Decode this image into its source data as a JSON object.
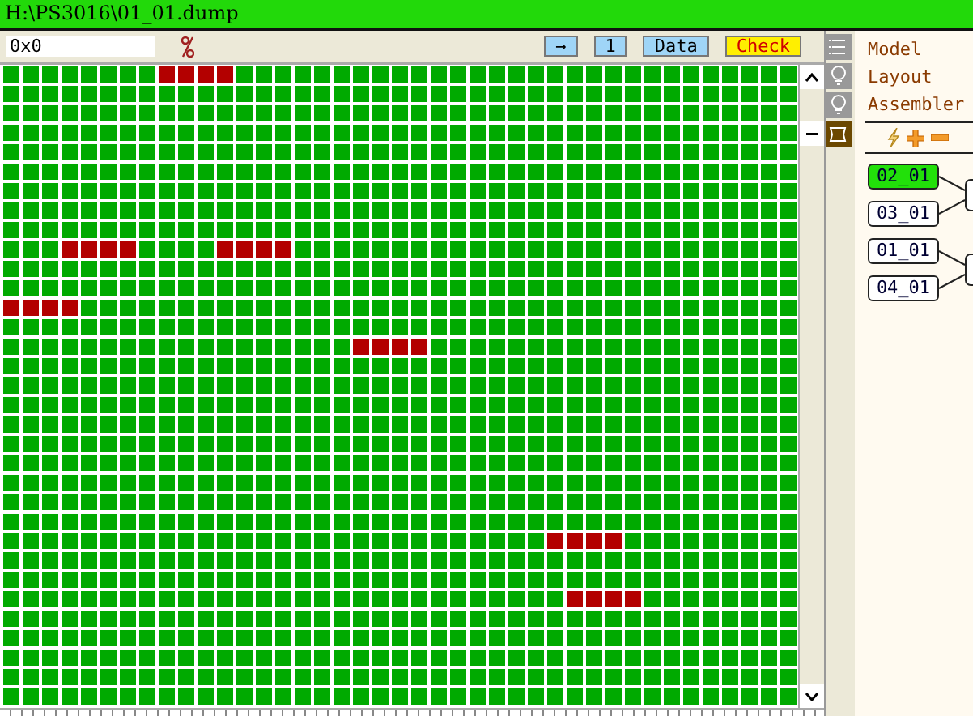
{
  "window": {
    "title": "H:\\PS3016\\01_01.dump"
  },
  "toolbar": {
    "address": {
      "value": "0x0"
    },
    "buttons": [
      {
        "label": "→",
        "kind": "plain"
      },
      {
        "label": "1",
        "kind": "plain"
      },
      {
        "label": "Data",
        "kind": "plain"
      },
      {
        "label": "Check",
        "kind": "warning"
      }
    ]
  },
  "grid": {
    "rows": [
      {
        "marked": [
          false,
          false,
          false,
          false,
          false,
          false,
          false,
          false,
          true,
          true,
          true,
          true,
          false,
          false,
          false,
          false,
          false,
          false,
          false,
          false,
          false,
          false,
          false,
          false,
          false,
          false,
          false,
          false,
          false,
          false,
          false,
          false,
          false,
          false,
          false,
          false,
          false,
          false,
          false,
          false,
          false
        ]
      },
      {
        "marked": [
          false,
          false,
          false,
          false,
          false,
          false,
          false,
          false,
          false,
          false,
          false,
          false,
          false,
          false,
          false,
          false,
          false,
          false,
          false,
          false,
          false,
          false,
          false,
          false,
          false,
          false,
          false,
          false,
          false,
          false,
          false,
          false,
          false,
          false,
          false,
          false,
          false,
          false,
          false,
          false,
          false
        ]
      },
      {
        "marked": [
          false,
          false,
          false,
          false,
          false,
          false,
          false,
          false,
          false,
          false,
          false,
          false,
          false,
          false,
          false,
          false,
          false,
          false,
          false,
          false,
          false,
          false,
          false,
          false,
          false,
          false,
          false,
          false,
          false,
          false,
          false,
          false,
          false,
          false,
          false,
          false,
          false,
          false,
          false,
          false,
          false
        ]
      },
      {
        "marked": [
          false,
          false,
          false,
          false,
          false,
          false,
          false,
          false,
          false,
          false,
          false,
          false,
          false,
          false,
          false,
          false,
          false,
          false,
          false,
          false,
          false,
          false,
          false,
          false,
          false,
          false,
          false,
          false,
          false,
          false,
          false,
          false,
          false,
          false,
          false,
          false,
          false,
          false,
          false,
          false,
          false
        ]
      },
      {
        "marked": [
          false,
          false,
          false,
          false,
          false,
          false,
          false,
          false,
          false,
          false,
          false,
          false,
          false,
          false,
          false,
          false,
          false,
          false,
          false,
          false,
          false,
          false,
          false,
          false,
          false,
          false,
          false,
          false,
          false,
          false,
          false,
          false,
          false,
          false,
          false,
          false,
          false,
          false,
          false,
          false,
          false
        ]
      },
      {
        "marked": [
          false,
          false,
          false,
          false,
          false,
          false,
          false,
          false,
          false,
          false,
          false,
          false,
          false,
          false,
          false,
          false,
          false,
          false,
          false,
          false,
          false,
          false,
          false,
          false,
          false,
          false,
          false,
          false,
          false,
          false,
          false,
          false,
          false,
          false,
          false,
          false,
          false,
          false,
          false,
          false,
          false
        ]
      },
      {
        "marked": [
          false,
          false,
          false,
          false,
          false,
          false,
          false,
          false,
          false,
          false,
          false,
          false,
          false,
          false,
          false,
          false,
          false,
          false,
          false,
          false,
          false,
          false,
          false,
          false,
          false,
          false,
          false,
          false,
          false,
          false,
          false,
          false,
          false,
          false,
          false,
          false,
          false,
          false,
          false,
          false,
          false
        ]
      },
      {
        "marked": [
          false,
          false,
          false,
          false,
          false,
          false,
          false,
          false,
          false,
          false,
          false,
          false,
          false,
          false,
          false,
          false,
          false,
          false,
          false,
          false,
          false,
          false,
          false,
          false,
          false,
          false,
          false,
          false,
          false,
          false,
          false,
          false,
          false,
          false,
          false,
          false,
          false,
          false,
          false,
          false,
          false
        ]
      },
      {
        "marked": [
          false,
          false,
          false,
          false,
          false,
          false,
          false,
          false,
          false,
          false,
          false,
          false,
          false,
          false,
          false,
          false,
          false,
          false,
          false,
          false,
          false,
          false,
          false,
          false,
          false,
          false,
          false,
          false,
          false,
          false,
          false,
          false,
          false,
          false,
          false,
          false,
          false,
          false,
          false,
          false,
          false
        ]
      },
      {
        "marked": [
          false,
          false,
          false,
          true,
          true,
          true,
          true,
          false,
          false,
          false,
          false,
          true,
          true,
          true,
          true,
          false,
          false,
          false,
          false,
          false,
          false,
          false,
          false,
          false,
          false,
          false,
          false,
          false,
          false,
          false,
          false,
          false,
          false,
          false,
          false,
          false,
          false,
          false,
          false,
          false,
          false
        ]
      },
      {
        "marked": [
          false,
          false,
          false,
          false,
          false,
          false,
          false,
          false,
          false,
          false,
          false,
          false,
          false,
          false,
          false,
          false,
          false,
          false,
          false,
          false,
          false,
          false,
          false,
          false,
          false,
          false,
          false,
          false,
          false,
          false,
          false,
          false,
          false,
          false,
          false,
          false,
          false,
          false,
          false,
          false,
          false
        ]
      },
      {
        "marked": [
          false,
          false,
          false,
          false,
          false,
          false,
          false,
          false,
          false,
          false,
          false,
          false,
          false,
          false,
          false,
          false,
          false,
          false,
          false,
          false,
          false,
          false,
          false,
          false,
          false,
          false,
          false,
          false,
          false,
          false,
          false,
          false,
          false,
          false,
          false,
          false,
          false,
          false,
          false,
          false,
          false
        ]
      },
      {
        "marked": [
          true,
          true,
          true,
          true,
          false,
          false,
          false,
          false,
          false,
          false,
          false,
          false,
          false,
          false,
          false,
          false,
          false,
          false,
          false,
          false,
          false,
          false,
          false,
          false,
          false,
          false,
          false,
          false,
          false,
          false,
          false,
          false,
          false,
          false,
          false,
          false,
          false,
          false,
          false,
          false,
          false
        ]
      },
      {
        "marked": [
          false,
          false,
          false,
          false,
          false,
          false,
          false,
          false,
          false,
          false,
          false,
          false,
          false,
          false,
          false,
          false,
          false,
          false,
          false,
          false,
          false,
          false,
          false,
          false,
          false,
          false,
          false,
          false,
          false,
          false,
          false,
          false,
          false,
          false,
          false,
          false,
          false,
          false,
          false,
          false,
          false
        ]
      },
      {
        "marked": [
          false,
          false,
          false,
          false,
          false,
          false,
          false,
          false,
          false,
          false,
          false,
          false,
          false,
          false,
          false,
          false,
          false,
          false,
          true,
          true,
          true,
          true,
          false,
          false,
          false,
          false,
          false,
          false,
          false,
          false,
          false,
          false,
          false,
          false,
          false,
          false,
          false,
          false,
          false,
          false,
          false
        ]
      },
      {
        "marked": [
          false,
          false,
          false,
          false,
          false,
          false,
          false,
          false,
          false,
          false,
          false,
          false,
          false,
          false,
          false,
          false,
          false,
          false,
          false,
          false,
          false,
          false,
          false,
          false,
          false,
          false,
          false,
          false,
          false,
          false,
          false,
          false,
          false,
          false,
          false,
          false,
          false,
          false,
          false,
          false,
          false
        ]
      },
      {
        "marked": [
          false,
          false,
          false,
          false,
          false,
          false,
          false,
          false,
          false,
          false,
          false,
          false,
          false,
          false,
          false,
          false,
          false,
          false,
          false,
          false,
          false,
          false,
          false,
          false,
          false,
          false,
          false,
          false,
          false,
          false,
          false,
          false,
          false,
          false,
          false,
          false,
          false,
          false,
          false,
          false,
          false
        ]
      },
      {
        "marked": [
          false,
          false,
          false,
          false,
          false,
          false,
          false,
          false,
          false,
          false,
          false,
          false,
          false,
          false,
          false,
          false,
          false,
          false,
          false,
          false,
          false,
          false,
          false,
          false,
          false,
          false,
          false,
          false,
          false,
          false,
          false,
          false,
          false,
          false,
          false,
          false,
          false,
          false,
          false,
          false,
          false
        ]
      },
      {
        "marked": [
          false,
          false,
          false,
          false,
          false,
          false,
          false,
          false,
          false,
          false,
          false,
          false,
          false,
          false,
          false,
          false,
          false,
          false,
          false,
          false,
          false,
          false,
          false,
          false,
          false,
          false,
          false,
          false,
          false,
          false,
          false,
          false,
          false,
          false,
          false,
          false,
          false,
          false,
          false,
          false,
          false
        ]
      },
      {
        "marked": [
          false,
          false,
          false,
          false,
          false,
          false,
          false,
          false,
          false,
          false,
          false,
          false,
          false,
          false,
          false,
          false,
          false,
          false,
          false,
          false,
          false,
          false,
          false,
          false,
          false,
          false,
          false,
          false,
          false,
          false,
          false,
          false,
          false,
          false,
          false,
          false,
          false,
          false,
          false,
          false,
          false
        ]
      },
      {
        "marked": [
          false,
          false,
          false,
          false,
          false,
          false,
          false,
          false,
          false,
          false,
          false,
          false,
          false,
          false,
          false,
          false,
          false,
          false,
          false,
          false,
          false,
          false,
          false,
          false,
          false,
          false,
          false,
          false,
          false,
          false,
          false,
          false,
          false,
          false,
          false,
          false,
          false,
          false,
          false,
          false,
          false
        ]
      },
      {
        "marked": [
          false,
          false,
          false,
          false,
          false,
          false,
          false,
          false,
          false,
          false,
          false,
          false,
          false,
          false,
          false,
          false,
          false,
          false,
          false,
          false,
          false,
          false,
          false,
          false,
          false,
          false,
          false,
          false,
          false,
          false,
          false,
          false,
          false,
          false,
          false,
          false,
          false,
          false,
          false,
          false,
          false
        ]
      },
      {
        "marked": [
          false,
          false,
          false,
          false,
          false,
          false,
          false,
          false,
          false,
          false,
          false,
          false,
          false,
          false,
          false,
          false,
          false,
          false,
          false,
          false,
          false,
          false,
          false,
          false,
          false,
          false,
          false,
          false,
          false,
          false,
          false,
          false,
          false,
          false,
          false,
          false,
          false,
          false,
          false,
          false,
          false
        ]
      },
      {
        "marked": [
          false,
          false,
          false,
          false,
          false,
          false,
          false,
          false,
          false,
          false,
          false,
          false,
          false,
          false,
          false,
          false,
          false,
          false,
          false,
          false,
          false,
          false,
          false,
          false,
          false,
          false,
          false,
          false,
          false,
          false,
          false,
          false,
          false,
          false,
          false,
          false,
          false,
          false,
          false,
          false,
          false
        ]
      },
      {
        "marked": [
          false,
          false,
          false,
          false,
          false,
          false,
          false,
          false,
          false,
          false,
          false,
          false,
          false,
          false,
          false,
          false,
          false,
          false,
          false,
          false,
          false,
          false,
          false,
          false,
          false,
          false,
          false,
          false,
          true,
          true,
          true,
          true,
          false,
          false,
          false,
          false,
          false,
          false,
          false,
          false,
          false
        ]
      },
      {
        "marked": [
          false,
          false,
          false,
          false,
          false,
          false,
          false,
          false,
          false,
          false,
          false,
          false,
          false,
          false,
          false,
          false,
          false,
          false,
          false,
          false,
          false,
          false,
          false,
          false,
          false,
          false,
          false,
          false,
          false,
          false,
          false,
          false,
          false,
          false,
          false,
          false,
          false,
          false,
          false,
          false,
          false
        ]
      },
      {
        "marked": [
          false,
          false,
          false,
          false,
          false,
          false,
          false,
          false,
          false,
          false,
          false,
          false,
          false,
          false,
          false,
          false,
          false,
          false,
          false,
          false,
          false,
          false,
          false,
          false,
          false,
          false,
          false,
          false,
          false,
          false,
          false,
          false,
          false,
          false,
          false,
          false,
          false,
          false,
          false,
          false,
          false
        ]
      },
      {
        "marked": [
          false,
          false,
          false,
          false,
          false,
          false,
          false,
          false,
          false,
          false,
          false,
          false,
          false,
          false,
          false,
          false,
          false,
          false,
          false,
          false,
          false,
          false,
          false,
          false,
          false,
          false,
          false,
          false,
          false,
          true,
          true,
          true,
          true,
          false,
          false,
          false,
          false,
          false,
          false,
          false,
          false
        ]
      },
      {
        "marked": [
          false,
          false,
          false,
          false,
          false,
          false,
          false,
          false,
          false,
          false,
          false,
          false,
          false,
          false,
          false,
          false,
          false,
          false,
          false,
          false,
          false,
          false,
          false,
          false,
          false,
          false,
          false,
          false,
          false,
          false,
          false,
          false,
          false,
          false,
          false,
          false,
          false,
          false,
          false,
          false,
          false
        ]
      },
      {
        "marked": [
          false,
          false,
          false,
          false,
          false,
          false,
          false,
          false,
          false,
          false,
          false,
          false,
          false,
          false,
          false,
          false,
          false,
          false,
          false,
          false,
          false,
          false,
          false,
          false,
          false,
          false,
          false,
          false,
          false,
          false,
          false,
          false,
          false,
          false,
          false,
          false,
          false,
          false,
          false,
          false,
          false
        ]
      },
      {
        "marked": [
          false,
          false,
          false,
          false,
          false,
          false,
          false,
          false,
          false,
          false,
          false,
          false,
          false,
          false,
          false,
          false,
          false,
          false,
          false,
          false,
          false,
          false,
          false,
          false,
          false,
          false,
          false,
          false,
          false,
          false,
          false,
          false,
          false,
          false,
          false,
          false,
          false,
          false,
          false,
          false,
          false
        ]
      },
      {
        "marked": [
          false,
          false,
          false,
          false,
          false,
          false,
          false,
          false,
          false,
          false,
          false,
          false,
          false,
          false,
          false,
          false,
          false,
          false,
          false,
          false,
          false,
          false,
          false,
          false,
          false,
          false,
          false,
          false,
          false,
          false,
          false,
          false,
          false,
          false,
          false,
          false,
          false,
          false,
          false,
          false,
          false
        ]
      },
      {
        "marked": [
          false,
          false,
          false,
          false,
          false,
          false,
          false,
          false,
          false,
          false,
          false,
          false,
          false,
          false,
          false,
          false,
          false,
          false,
          false,
          false,
          false,
          false,
          false,
          false,
          false,
          false,
          false,
          false,
          false,
          false,
          false,
          false,
          false,
          false,
          false,
          false,
          false,
          false,
          false,
          false,
          false
        ]
      }
    ]
  },
  "side_tabs": [
    {
      "label": "Model",
      "selected": false
    },
    {
      "label": "Layout",
      "selected": false
    },
    {
      "label": "Assembler",
      "selected": false
    },
    {
      "selected": true
    }
  ],
  "tree": {
    "groups": [
      {
        "nodes": [
          {
            "label": "02_01",
            "selected": true
          },
          {
            "label": "03_01",
            "selected": false
          }
        ]
      },
      {
        "nodes": [
          {
            "label": "01_01",
            "selected": false
          },
          {
            "label": "04_01",
            "selected": false
          }
        ]
      }
    ]
  }
}
